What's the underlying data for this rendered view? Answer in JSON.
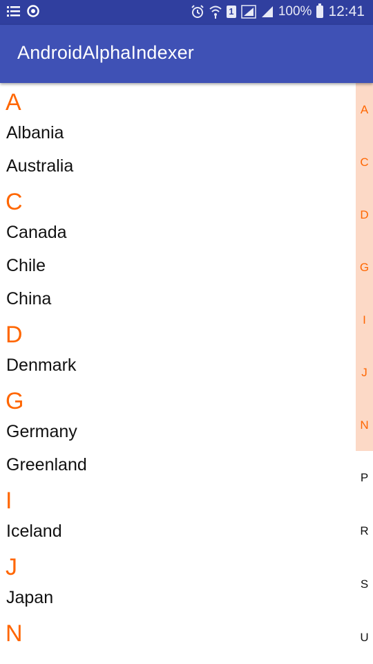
{
  "status_bar": {
    "left_icons": [
      "list-notification-icon",
      "sync-icon"
    ],
    "right_icons": [
      "alarm-icon",
      "wifi-icon",
      "sim-icon",
      "signal-icon",
      "signal-icon",
      "battery-icon"
    ],
    "sim_number": "1",
    "battery": "100%",
    "time": "12:41"
  },
  "app_bar": {
    "title": "AndroidAlphaIndexer"
  },
  "list": {
    "sections": [
      {
        "letter": "A",
        "items": [
          "Albania",
          "Australia"
        ]
      },
      {
        "letter": "C",
        "items": [
          "Canada",
          "Chile",
          "China"
        ]
      },
      {
        "letter": "D",
        "items": [
          "Denmark"
        ]
      },
      {
        "letter": "G",
        "items": [
          "Germany",
          "Greenland"
        ]
      },
      {
        "letter": "I",
        "items": [
          "Iceland"
        ]
      },
      {
        "letter": "J",
        "items": [
          "Japan"
        ]
      },
      {
        "letter": "N",
        "items": []
      }
    ]
  },
  "indexer": {
    "highlight_color": "#FCD9C6",
    "active_color": "#FF6600",
    "letters": [
      {
        "letter": "A",
        "active": true
      },
      {
        "letter": "C",
        "active": true
      },
      {
        "letter": "D",
        "active": true
      },
      {
        "letter": "G",
        "active": true
      },
      {
        "letter": "I",
        "active": true
      },
      {
        "letter": "J",
        "active": true
      },
      {
        "letter": "N",
        "active": true
      },
      {
        "letter": "P",
        "active": false
      },
      {
        "letter": "R",
        "active": false
      },
      {
        "letter": "S",
        "active": false
      },
      {
        "letter": "U",
        "active": false
      }
    ]
  }
}
